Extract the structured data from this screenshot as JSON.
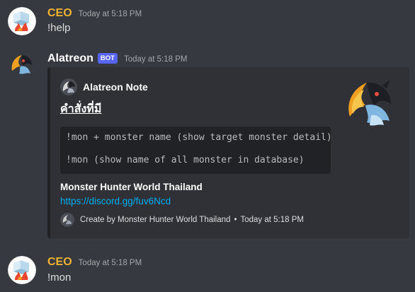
{
  "messages": [
    {
      "username": "CEO",
      "username_color": "#f0b232",
      "timestamp": "Today at 5:18 PM",
      "text": "!help",
      "avatar_icon": "ice-fire-avatar"
    },
    {
      "username": "Alatreon",
      "username_color": "#ffffff",
      "bot_tag": "BOT",
      "timestamp": "Today at 5:18 PM",
      "avatar_icon": "dragon-avatar",
      "embed": {
        "author": "Alatreon Note",
        "title": "คำสั่งที่มี",
        "code_lines": [
          "!mon + monster name (show target monster detail)",
          "",
          "!mon (show name of all monster in database)"
        ],
        "field_name": "Monster Hunter World Thailand",
        "field_link": "https://discord.gg/fuv6Ncd",
        "footer_text": "Create by Monster Hunter World Thailand",
        "footer_separator": "•",
        "footer_time": "Today at 5:18 PM",
        "thumbnail_icon": "dragon-thumbnail"
      }
    },
    {
      "username": "CEO",
      "username_color": "#f0b232",
      "timestamp": "Today at 5:18 PM",
      "text": "!mon",
      "avatar_icon": "ice-fire-avatar"
    }
  ],
  "colors": {
    "background": "#36393f",
    "embed_background": "#2f3136",
    "link": "#00aff4",
    "bot_tag": "#5865f2"
  }
}
